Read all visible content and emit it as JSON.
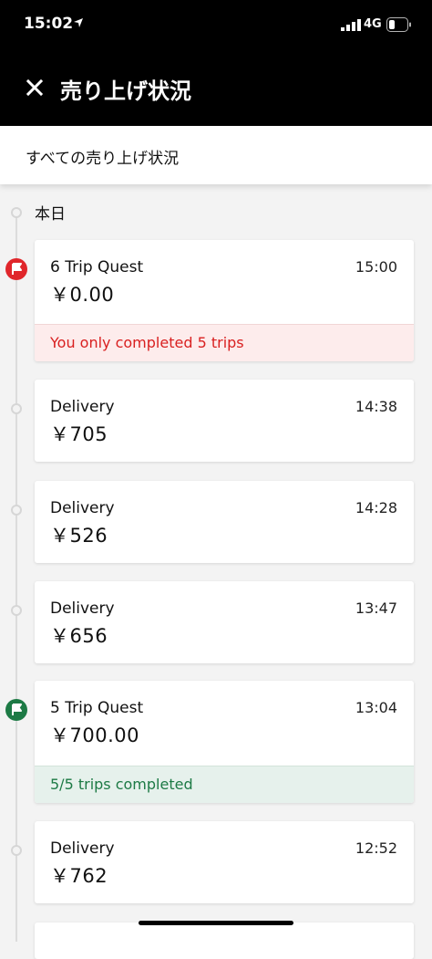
{
  "status_bar": {
    "time": "15:02",
    "network": "4G"
  },
  "nav": {
    "title": "売り上げ状況"
  },
  "filter": {
    "label": "すべての売り上げ状況"
  },
  "section": {
    "date": "本日"
  },
  "items": [
    {
      "title": "6 Trip Quest",
      "amount": "￥0.00",
      "time": "15:00",
      "note": "You only completed 5 trips",
      "kind": "quest-failed"
    },
    {
      "title": "Delivery",
      "amount": "￥705",
      "time": "14:38",
      "kind": "delivery"
    },
    {
      "title": "Delivery",
      "amount": "￥526",
      "time": "14:28",
      "kind": "delivery"
    },
    {
      "title": "Delivery",
      "amount": "￥656",
      "time": "13:47",
      "kind": "delivery"
    },
    {
      "title": "5 Trip Quest",
      "amount": "￥700.00",
      "time": "13:04",
      "note": "5/5 trips completed",
      "kind": "quest-completed"
    },
    {
      "title": "Delivery",
      "amount": "￥762",
      "time": "12:52",
      "kind": "delivery"
    }
  ],
  "colors": {
    "fail": "#e0262b",
    "success": "#1d7a45",
    "header": "#000000"
  },
  "icons": {
    "close": "close-icon",
    "quest_failed": "red-flag-icon",
    "quest_completed": "green-flag-icon"
  }
}
